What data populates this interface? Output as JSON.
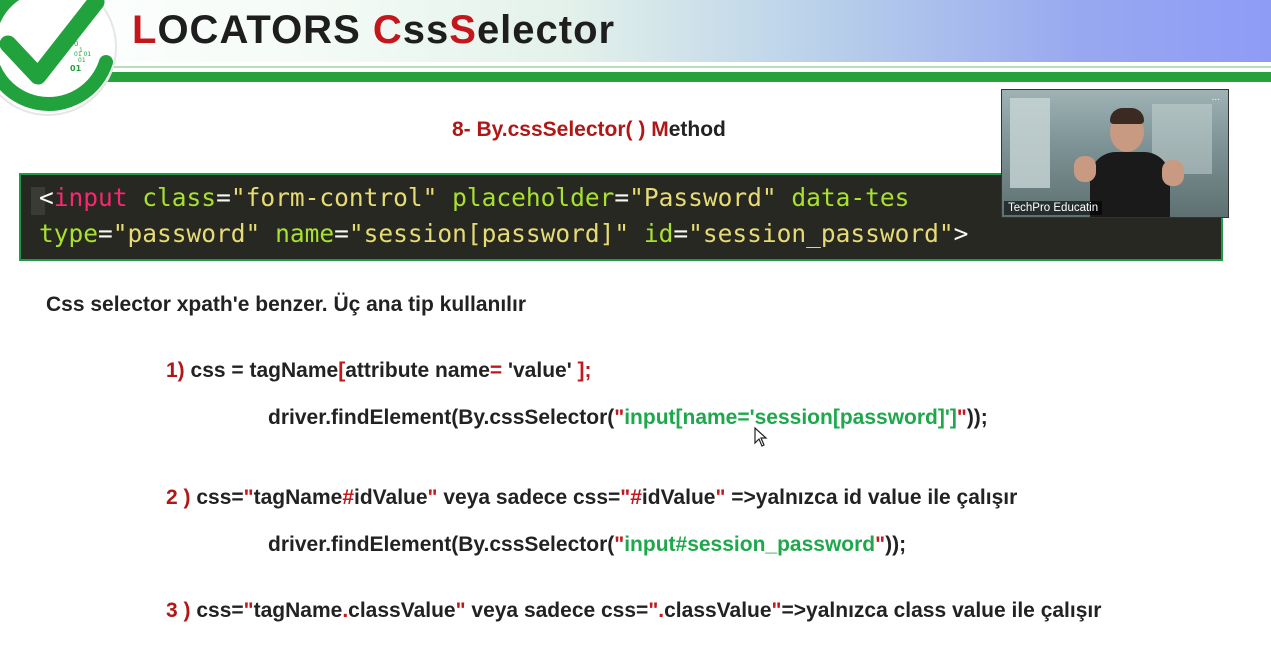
{
  "header": {
    "title": {
      "l1": "L",
      "l2": "OCATORS ",
      "c1": "C",
      "c2": "ss",
      "s1": "S",
      "s2": "elector"
    },
    "logo": {
      "icon": "checkmark-icon",
      "binary": [
        "0",
        "1",
        "01 01",
        "01",
        "01"
      ]
    }
  },
  "subtitle": {
    "prefix": "8- By.cssSelector( ) M",
    "rest": "ethod"
  },
  "code": {
    "line1": {
      "open": "<",
      "tag": "input",
      "a1": "class",
      "v1": "\"form-control\"",
      "a2": "placeholder",
      "v2": "\"Password\"",
      "a3": "data-tes"
    },
    "line2": {
      "a1": "type",
      "v1": "\"password\"",
      "a2": "name",
      "v2": "\"session[password]\"",
      "a3": "id",
      "v3": "\"session_password\"",
      "close": ">"
    }
  },
  "intro": "Css selector xpath'e benzer. Üç ana tip kullanılır",
  "rules": {
    "r1": {
      "num": "1)",
      "a": " css = tagName",
      "b": "[",
      "c": "attribute name",
      "d": "=",
      "e": " 'value'",
      "f": " ];"
    },
    "e1": {
      "a": "driver.findElement(By.cssSelector(",
      "q1": "\"",
      "g": "input[name='session[password]']",
      "q2": "\"",
      "b": "));"
    },
    "r2": {
      "num": "2 )",
      "a": " css=",
      "q1": "\"",
      "b": "tagName",
      "hash": "#",
      "c": "idValue",
      "q2": "\"",
      "d": " veya sadece css=",
      "q3": "\"",
      "hash2": "#",
      "e": "idValue",
      "q4": "\"",
      "f": " =>yalnızca id value ile  çalışır"
    },
    "e2": {
      "a": "driver.findElement(By.cssSelector(",
      "q1": "\"",
      "g": "input#session_password",
      "q2": "\"",
      "b": "));"
    },
    "r3": {
      "num": "3 )",
      "a": " css=",
      "q1": "\"",
      "b": "tagName",
      "dot": ".",
      "c": "classValue",
      "q2": "\"",
      "d": " veya sadece css=",
      "q3": "\"",
      "dot2": ".",
      "e": "classValue",
      "q4": "\"",
      "f": "=>yalnızca class value ile  çalışır"
    }
  },
  "video": {
    "label": "TechPro Educatin",
    "menu": "..."
  },
  "colors": {
    "accent_red": "#c4161c",
    "code_green": "#1ea84b",
    "header_green": "#25a33a",
    "code_bg": "#272822"
  }
}
